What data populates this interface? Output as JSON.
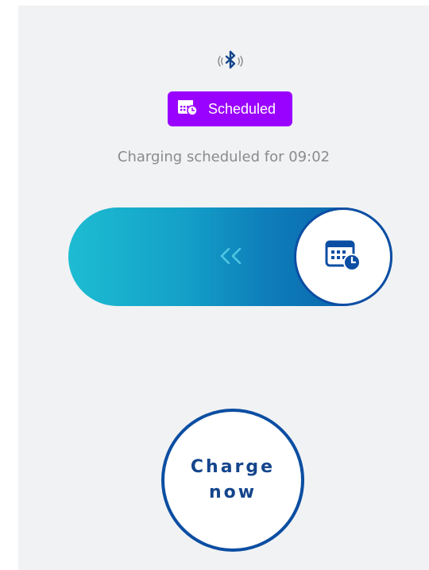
{
  "header": {
    "bluetooth_icon": "bluetooth-icon"
  },
  "badge": {
    "label": "Scheduled",
    "icon": "calendar-clock-icon",
    "color": "#9a02ff"
  },
  "status": {
    "text": "Charging scheduled for 09:02"
  },
  "slider": {
    "arrows_icon": "double-chevron-left-icon",
    "knob_icon": "calendar-clock-icon",
    "gradient_start": "#1dbcd2",
    "gradient_end": "#0a5aa6"
  },
  "action": {
    "label": "Charge now",
    "border_color": "#0b4ea2"
  }
}
